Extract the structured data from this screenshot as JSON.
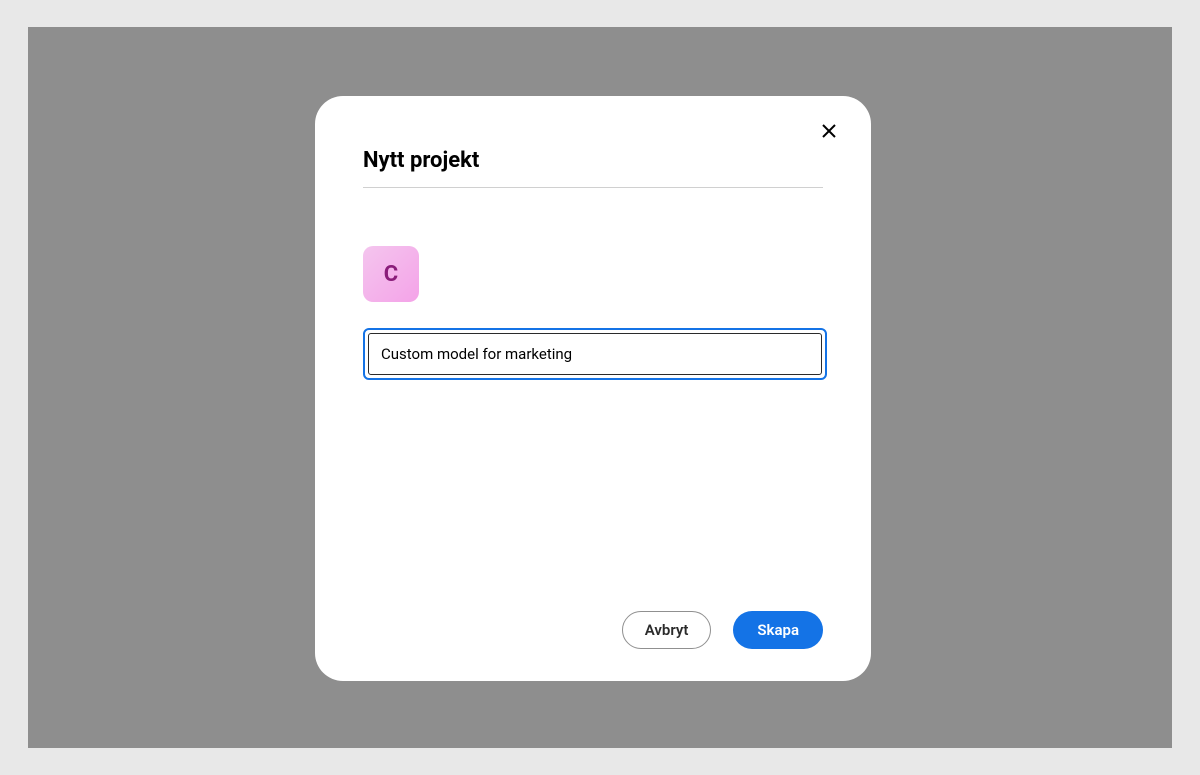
{
  "modal": {
    "title": "Nytt projekt",
    "icon_letter": "C",
    "name_input_value": "Custom model for marketing",
    "cancel_label": "Avbryt",
    "create_label": "Skapa"
  }
}
